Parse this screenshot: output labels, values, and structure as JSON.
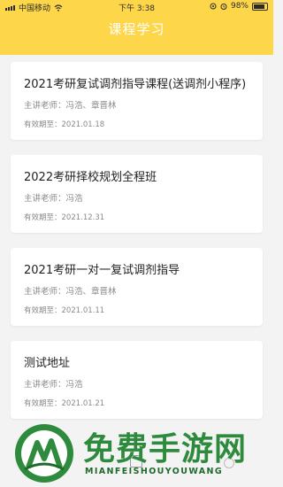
{
  "status_bar": {
    "carrier": "中国移动",
    "time": "下午 3:38",
    "battery": "98%"
  },
  "header": {
    "title": "课程学习"
  },
  "courses": [
    {
      "title": "2021考研复试调剂指导课程(送调剂小程序)",
      "teacher": "主讲老师：冯浩、章晋林",
      "expiry": "有效期至：2021.01.18"
    },
    {
      "title": "2022考研择校规划全程班",
      "teacher": "主讲老师：冯浩",
      "expiry": "有效期至：2021.12.31"
    },
    {
      "title": "2021考研一对一复试调剂指导",
      "teacher": "主讲老师：冯浩、章晋林",
      "expiry": "有效期至：2021.01.11"
    },
    {
      "title": "测试地址",
      "teacher": "主讲老师：冯浩",
      "expiry": "有效期至：2021.01.21"
    }
  ],
  "watermark": {
    "text": "免费手游网",
    "subtext": "MIANFEISHOUYOUWANG"
  },
  "colors": {
    "header": "#fdd64a",
    "background": "#f3f3f3",
    "watermark": "#2e8a3c"
  }
}
